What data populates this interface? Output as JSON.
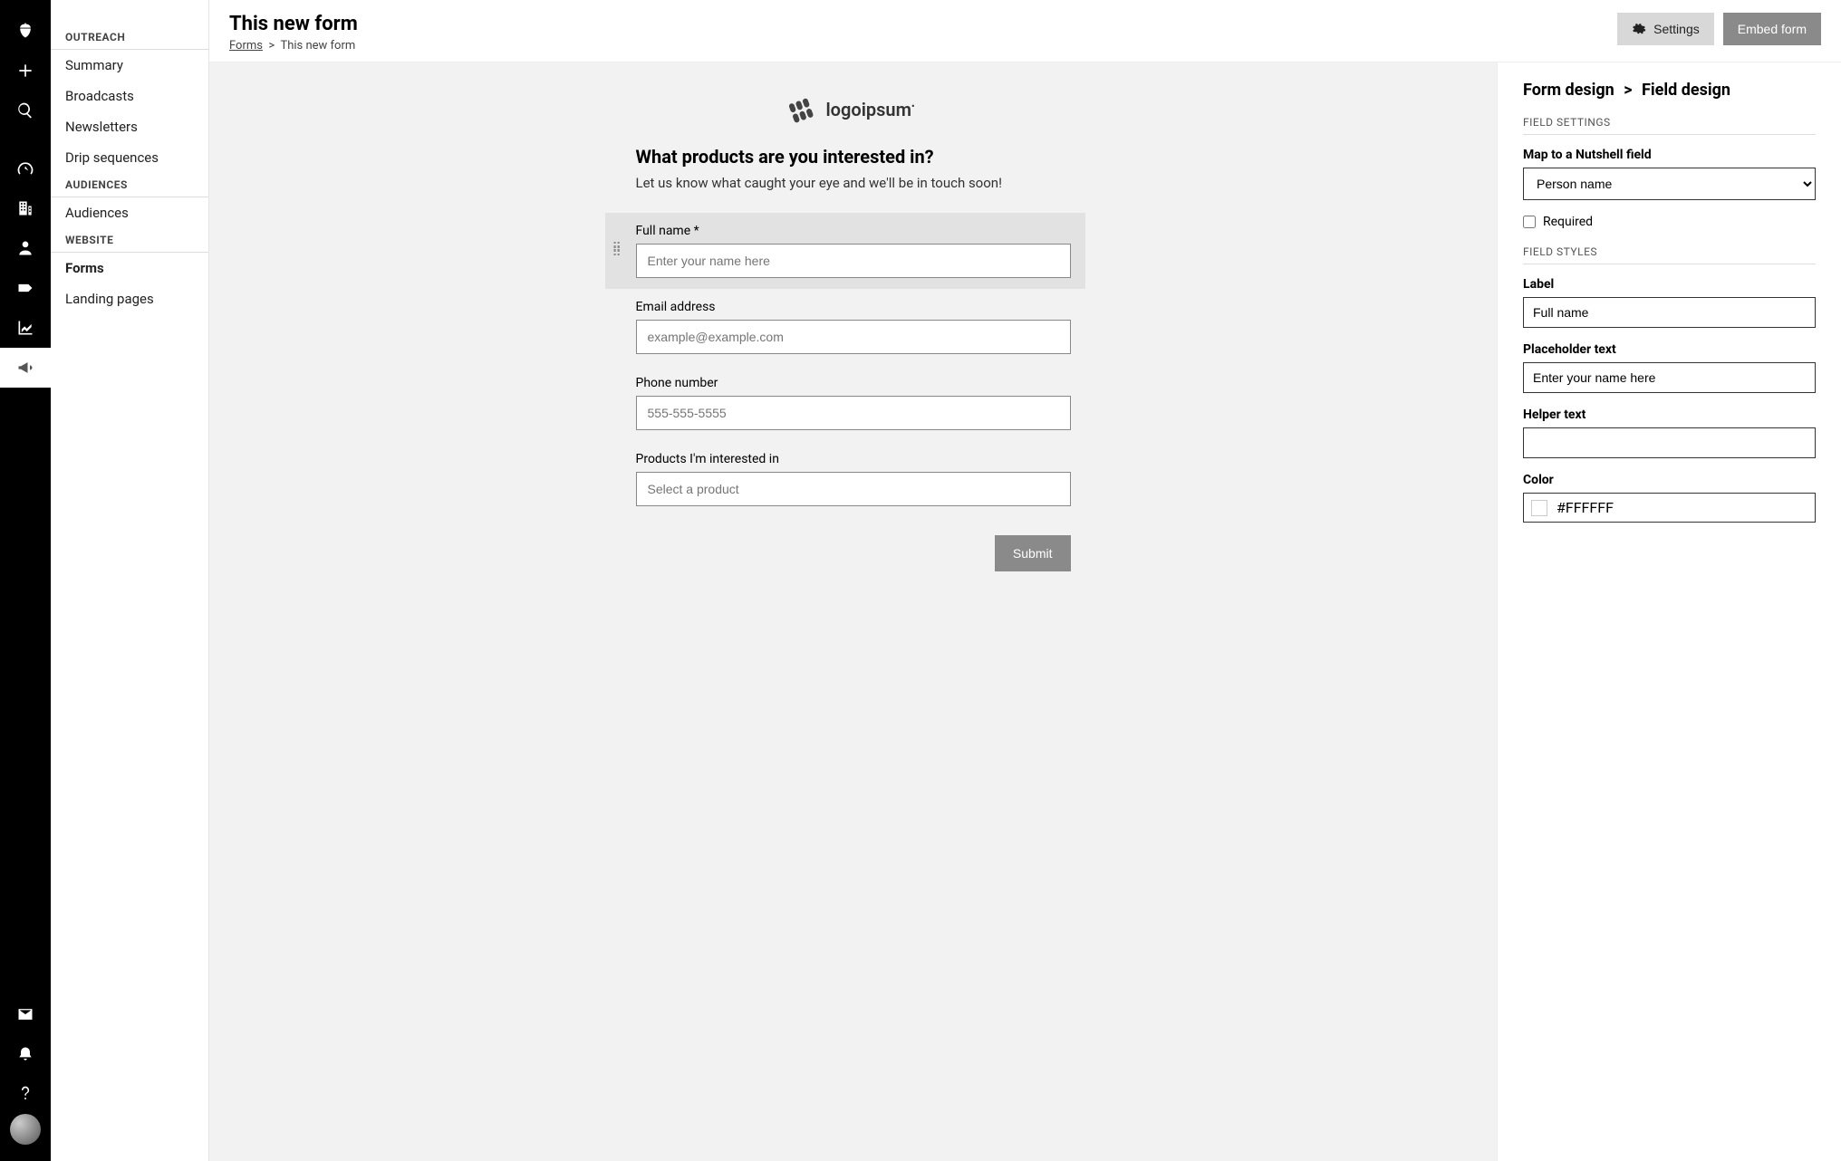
{
  "sidebar": {
    "sections": [
      {
        "title": "OUTREACH",
        "items": [
          "Summary",
          "Broadcasts",
          "Newsletters",
          "Drip sequences"
        ]
      },
      {
        "title": "AUDIENCES",
        "items": [
          "Audiences"
        ]
      },
      {
        "title": "WEBSITE",
        "items": [
          "Forms",
          "Landing pages"
        ]
      }
    ],
    "active": "Forms"
  },
  "header": {
    "title": "This new form",
    "breadcrumb": {
      "root": "Forms",
      "current": "This new form"
    },
    "settings_label": "Settings",
    "embed_label": "Embed form"
  },
  "form": {
    "logo_text": "logoipsum",
    "heading": "What products are you interested in?",
    "subheading": "Let us know what caught your eye and we'll be in touch soon!",
    "fields": [
      {
        "label": "Full name *",
        "placeholder": "Enter your name here",
        "selected": true
      },
      {
        "label": "Email address",
        "placeholder": "example@example.com",
        "selected": false
      },
      {
        "label": "Phone number",
        "placeholder": "555-555-5555",
        "selected": false
      },
      {
        "label": "Products I'm interested in",
        "placeholder": "Select a product",
        "selected": false
      }
    ],
    "submit_label": "Submit"
  },
  "panel": {
    "crumb1": "Form design",
    "crumb2": "Field design",
    "section_settings": "FIELD SETTINGS",
    "map_label": "Map to a Nutshell field",
    "map_value": "Person name",
    "required_label": "Required",
    "section_styles": "FIELD STYLES",
    "label_label": "Label",
    "label_value": "Full name",
    "placeholder_label": "Placeholder text",
    "placeholder_value": "Enter your name here",
    "helper_label": "Helper text",
    "helper_value": "",
    "color_label": "Color",
    "color_value": "#FFFFFF"
  }
}
